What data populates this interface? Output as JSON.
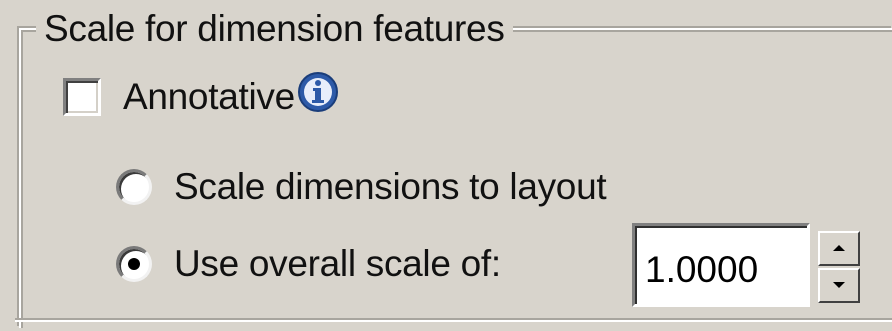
{
  "group": {
    "title": "Scale for dimension features"
  },
  "annotative": {
    "label": "Annotative",
    "checked": false,
    "icon": "info-icon"
  },
  "radios": [
    {
      "label": "Scale dimensions to layout",
      "selected": false
    },
    {
      "label": "Use overall scale of:",
      "selected": true
    }
  ],
  "overall_scale": {
    "value": "1.0000",
    "up_icon": "spin-up-arrow-icon",
    "down_icon": "spin-down-arrow-icon"
  },
  "colors": {
    "dialog_bg": "#d8d4cc",
    "info_icon_blue": "#2d5aa8"
  }
}
